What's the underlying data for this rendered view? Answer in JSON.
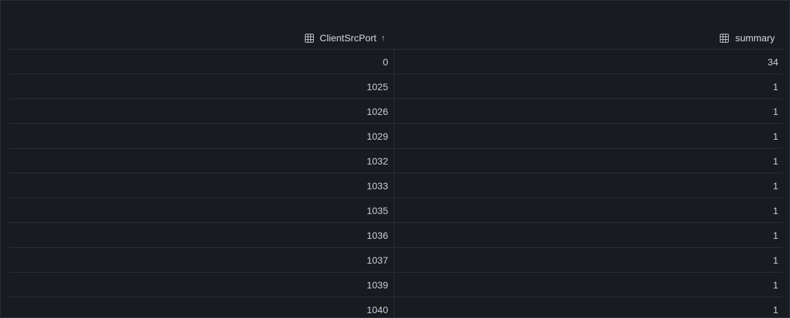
{
  "table": {
    "columns": [
      {
        "label": "ClientSrcPort",
        "sort": "ascending",
        "icon": "table-field-icon"
      },
      {
        "label": "summary",
        "icon": "table-field-icon"
      }
    ],
    "rows": [
      [
        "0",
        "34"
      ],
      [
        "1025",
        "1"
      ],
      [
        "1026",
        "1"
      ],
      [
        "1029",
        "1"
      ],
      [
        "1032",
        "1"
      ],
      [
        "1033",
        "1"
      ],
      [
        "1035",
        "1"
      ],
      [
        "1036",
        "1"
      ],
      [
        "1037",
        "1"
      ],
      [
        "1039",
        "1"
      ],
      [
        "1040",
        "1"
      ]
    ]
  }
}
